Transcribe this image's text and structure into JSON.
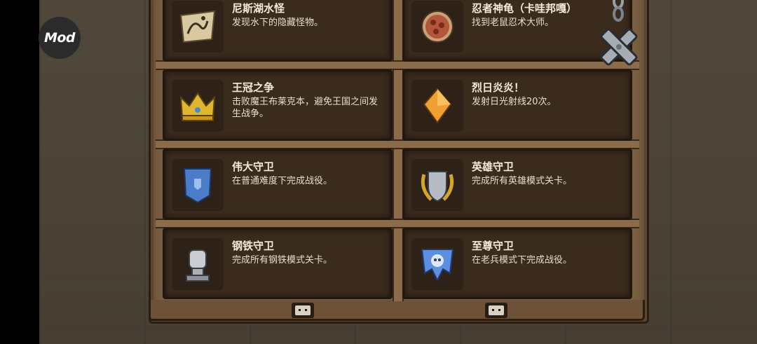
{
  "mod_badge": {
    "label": "Mod"
  },
  "achievements": [
    {
      "title": "尼斯湖水怪",
      "desc": "发现水下的隐藏怪物。",
      "icon": "map-icon"
    },
    {
      "title": "忍者神龟（卡哇邦嘎）",
      "desc": "找到老鼠忍术大师。",
      "icon": "pizza-icon"
    },
    {
      "title": "王冠之争",
      "desc": "击败魔王布莱克本，避免王国之间发生战争。",
      "icon": "crown-icon"
    },
    {
      "title": "烈日炎炎！",
      "desc": "发射日光射线20次。",
      "icon": "crystal-icon"
    },
    {
      "title": "伟大守卫",
      "desc": "在普通难度下完成战役。",
      "icon": "blue-banner-icon"
    },
    {
      "title": "英雄守卫",
      "desc": "完成所有英雄模式关卡。",
      "icon": "laurel-shield-icon"
    },
    {
      "title": "钢铁守卫",
      "desc": "完成所有钢铁模式关卡。",
      "icon": "iron-fist-icon"
    },
    {
      "title": "至尊守卫",
      "desc": "在老兵模式下完成战役。",
      "icon": "skull-banner-icon"
    }
  ],
  "colors": {
    "board_wood": "#7a6042",
    "cell_bg": "#3a2b1d",
    "text": "#f4ead8"
  }
}
